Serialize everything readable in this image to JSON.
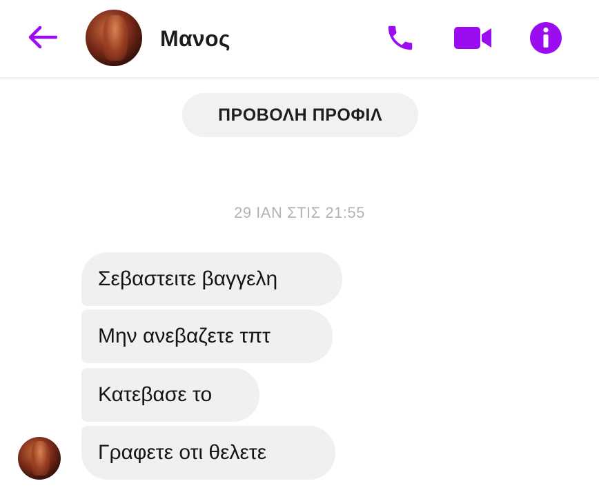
{
  "header": {
    "contact_name": "Μανος",
    "icons": {
      "back": "back-arrow-icon",
      "avatar": "contact-avatar",
      "call": "phone-icon",
      "video": "video-camera-icon",
      "info": "info-icon"
    }
  },
  "profile_button": {
    "label": "ΠΡΟΒΟΛΗ ΠΡΟΦΙΛ"
  },
  "conversation": {
    "timestamp": "29 ΙΑΝ ΣΤΙΣ 21:55",
    "messages": [
      {
        "text": "Σεβαστειτε βαγγελη"
      },
      {
        "text": "Μην ανεβαζετε τπτ"
      },
      {
        "text": "Κατεβασε το"
      },
      {
        "text": "Γραφετε οτι θελετε"
      }
    ]
  },
  "colors": {
    "accent": "#9b0cf0",
    "bubble_bg": "#f0f0f0",
    "timestamp": "#b3b3b3",
    "text": "#141414"
  }
}
